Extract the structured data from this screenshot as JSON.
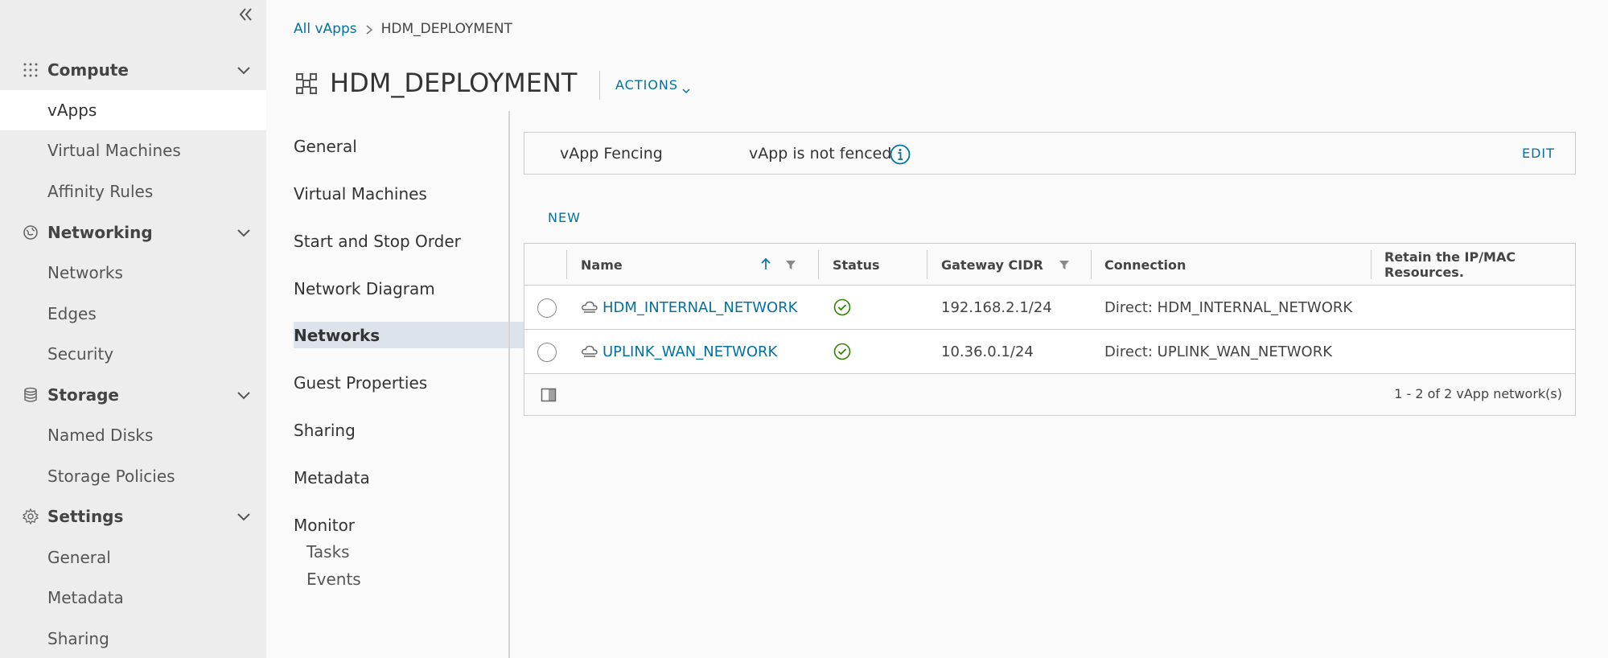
{
  "sidebar": {
    "groups": [
      {
        "label": "Compute",
        "icon": "grid-icon",
        "items": [
          "vApps",
          "Virtual Machines",
          "Affinity Rules"
        ]
      },
      {
        "label": "Networking",
        "icon": "network-icon",
        "items": [
          "Networks",
          "Edges",
          "Security"
        ]
      },
      {
        "label": "Storage",
        "icon": "storage-icon",
        "items": [
          "Named Disks",
          "Storage Policies"
        ]
      },
      {
        "label": "Settings",
        "icon": "gear-icon",
        "items": [
          "General",
          "Metadata",
          "Sharing"
        ]
      }
    ],
    "active_item": "vApps"
  },
  "breadcrumb": {
    "root": "All vApps",
    "current": "HDM_DEPLOYMENT"
  },
  "header": {
    "title": "HDM_DEPLOYMENT",
    "actions_label": "ACTIONS"
  },
  "subnav": {
    "items": [
      "General",
      "Virtual Machines",
      "Start and Stop Order",
      "Network Diagram",
      "Networks",
      "Guest Properties",
      "Sharing",
      "Metadata",
      "Monitor"
    ],
    "monitor_children": [
      "Tasks",
      "Events"
    ],
    "active": "Networks"
  },
  "fencing": {
    "label": "vApp Fencing",
    "value": "vApp is not fenced",
    "edit_label": "EDIT"
  },
  "new_label": "NEW",
  "grid": {
    "columns": [
      "Name",
      "Status",
      "Gateway CIDR",
      "Connection",
      "Retain the IP/MAC Resources."
    ],
    "rows": [
      {
        "name": "HDM_INTERNAL_NETWORK",
        "status": "ok",
        "gateway": "192.168.2.1/24",
        "connection": "Direct: HDM_INTERNAL_NETWORK"
      },
      {
        "name": "UPLINK_WAN_NETWORK",
        "status": "ok",
        "gateway": "10.36.0.1/24",
        "connection": "Direct: UPLINK_WAN_NETWORK"
      }
    ],
    "footer_count": "1 - 2 of 2 vApp network(s)"
  },
  "colors": {
    "link": "#0072a3",
    "success": "#2f8400",
    "sidebar_bg": "#ededed",
    "active_subnav": "#dde3ea"
  }
}
